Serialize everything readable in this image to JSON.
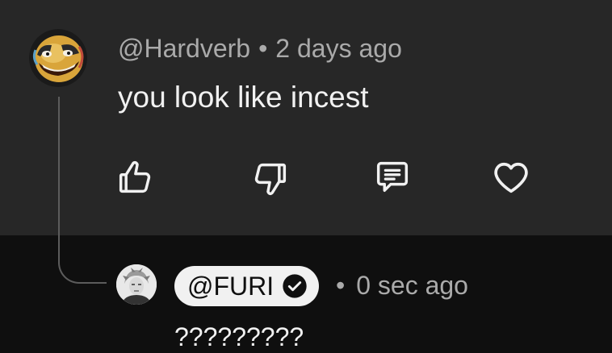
{
  "comment": {
    "handle": "@Hardverb",
    "separator": "•",
    "time": "2 days ago",
    "text": "you look like incest",
    "actions": [
      {
        "name": "like",
        "icon": "thumbs-up-icon"
      },
      {
        "name": "dislike",
        "icon": "thumbs-down-icon"
      },
      {
        "name": "reply",
        "icon": "comment-icon"
      },
      {
        "name": "heart",
        "icon": "heart-icon"
      }
    ]
  },
  "reply": {
    "handle": "@FURI",
    "verified_icon": "verified-check-icon",
    "separator": "•",
    "time": "0 sec ago",
    "text": "?????????"
  },
  "colors": {
    "top_background": "#272727",
    "bottom_background": "#0f0f0f",
    "primary_text": "#f1f1f1",
    "secondary_text": "#aaaaaa",
    "thread_line": "#5c5c5c"
  }
}
